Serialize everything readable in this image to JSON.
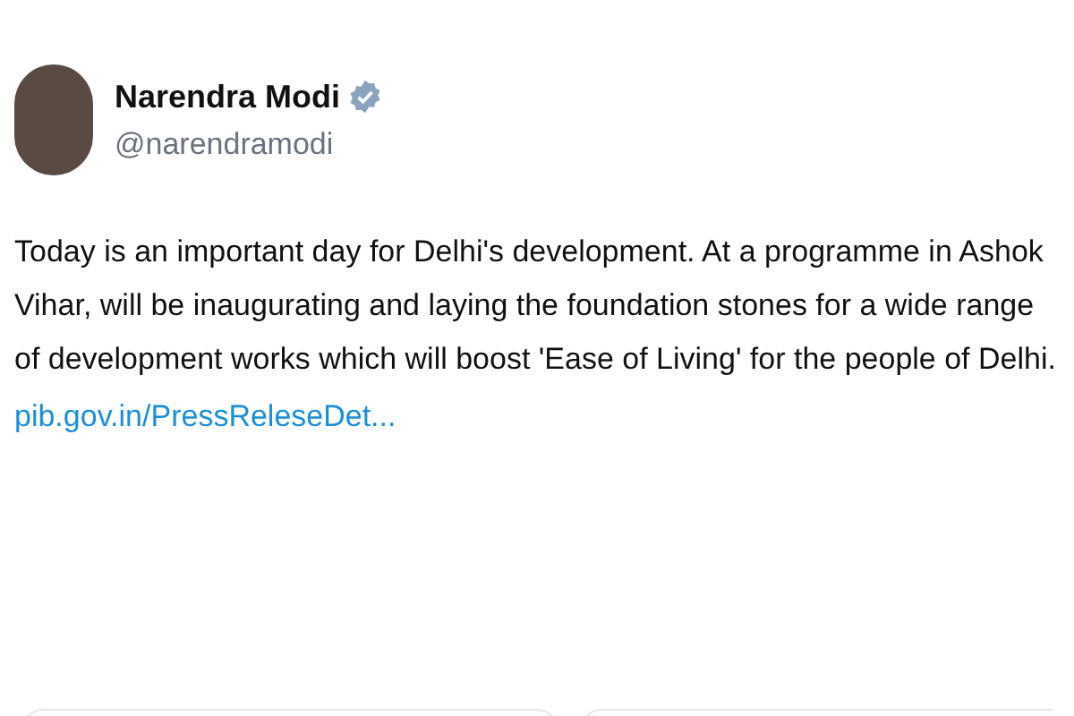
{
  "author": {
    "name": "Narendra Modi",
    "verified": true,
    "handle": "@narendramodi"
  },
  "post": {
    "text": "Today is an important day for Delhi's development. At a programme in Ashok Vihar, will be inaugurating and laying the foundation stones for a wide range of development works which will boost 'Ease of Living' for the people of Delhi.",
    "link": "pib.gov.in/PressReleseDet..."
  }
}
